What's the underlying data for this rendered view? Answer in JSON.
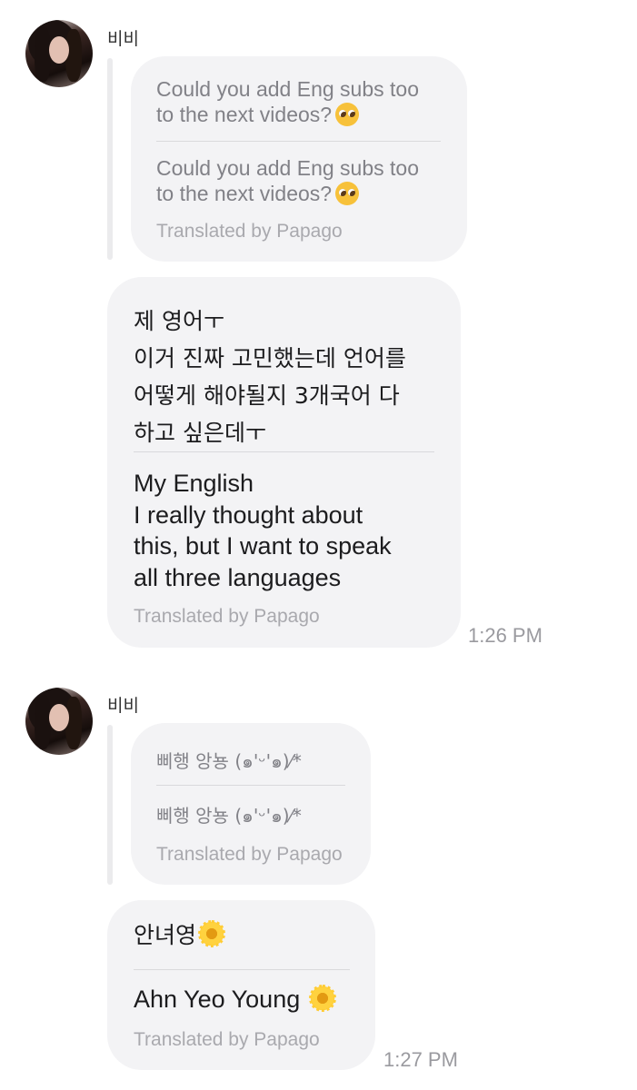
{
  "messages": [
    {
      "sender": "비비",
      "quote": {
        "original": "Could you add Eng subs too\nto the next videos?",
        "translated": "Could you add Eng subs too\nto the next videos?",
        "original_emoji": "pleading-face",
        "translated_emoji": "pleading-face",
        "translated_by": "Translated by Papago"
      },
      "reply": {
        "original": "제 영어ㅜ\n이거 진짜 고민했는데 언어를\n어떻게 해야될지 3개국어 다\n하고 싶은데ㅜ",
        "translated": "My English\nI really thought about\nthis, but I want to speak\nall three languages",
        "translated_by": "Translated by Papago",
        "time": "1:26 PM"
      }
    },
    {
      "sender": "비비",
      "quote": {
        "original": "삐행 앙뇽 (๑'ᵕ'๑)⁄*",
        "translated": "삐행 앙뇽 (๑'ᵕ'๑)⁄*",
        "translated_by": "Translated by Papago"
      },
      "reply": {
        "original": "안녀영",
        "original_emoji": "blossom",
        "translated": "Ahn Yeo Young",
        "translated_emoji": "blossom",
        "translated_by": "Translated by Papago",
        "time": "1:27 PM"
      }
    }
  ],
  "colors": {
    "bubble": "#f3f3f5",
    "quote_text": "#818187",
    "message_text": "#1c1c1e",
    "meta_text": "#a9a9ae"
  }
}
